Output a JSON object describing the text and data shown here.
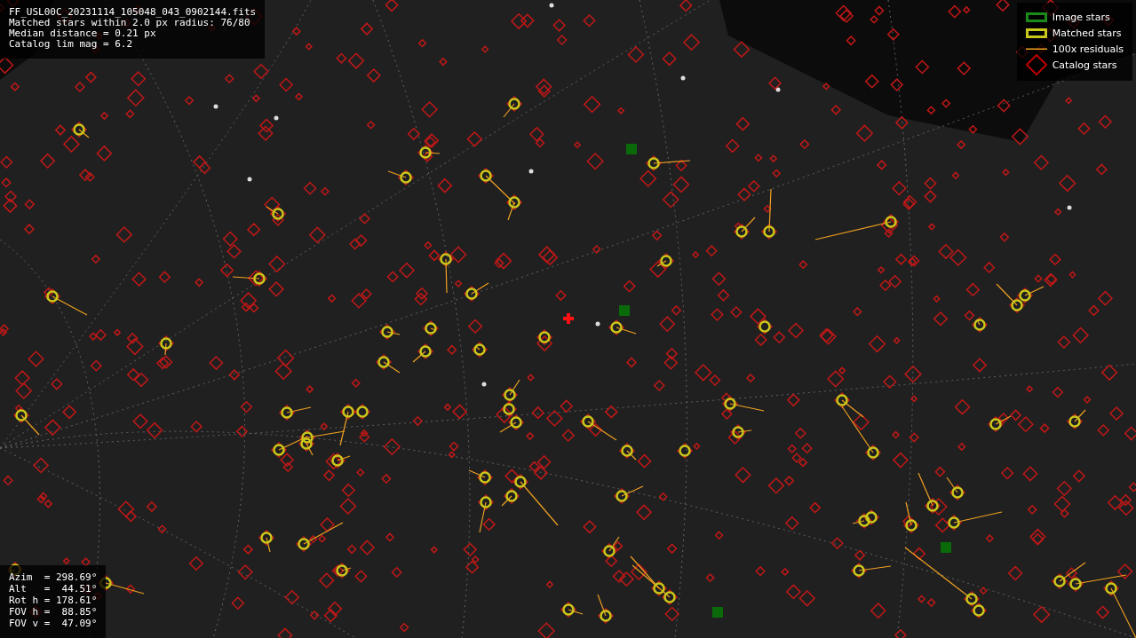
{
  "info_lines": [
    "FF_USL00C_20231114_105048_043_0902144.fits",
    "Matched stars within 2.0 px radius: 76/80",
    "Median distance = 0.21 px",
    "Catalog lim mag = 6.2"
  ],
  "legend": [
    {
      "kind": "image",
      "label": "Image stars"
    },
    {
      "kind": "matched",
      "label": "Matched stars"
    },
    {
      "kind": "residual",
      "label": "100x residuals"
    },
    {
      "kind": "catalog",
      "label": "Catalog stars"
    }
  ],
  "pointing": [
    "Azim  = 298.69°",
    "Alt   =  44.51°",
    "Rot h = 178.61°",
    "FOV h =  88.85°",
    "FOV v =  47.09°"
  ]
}
